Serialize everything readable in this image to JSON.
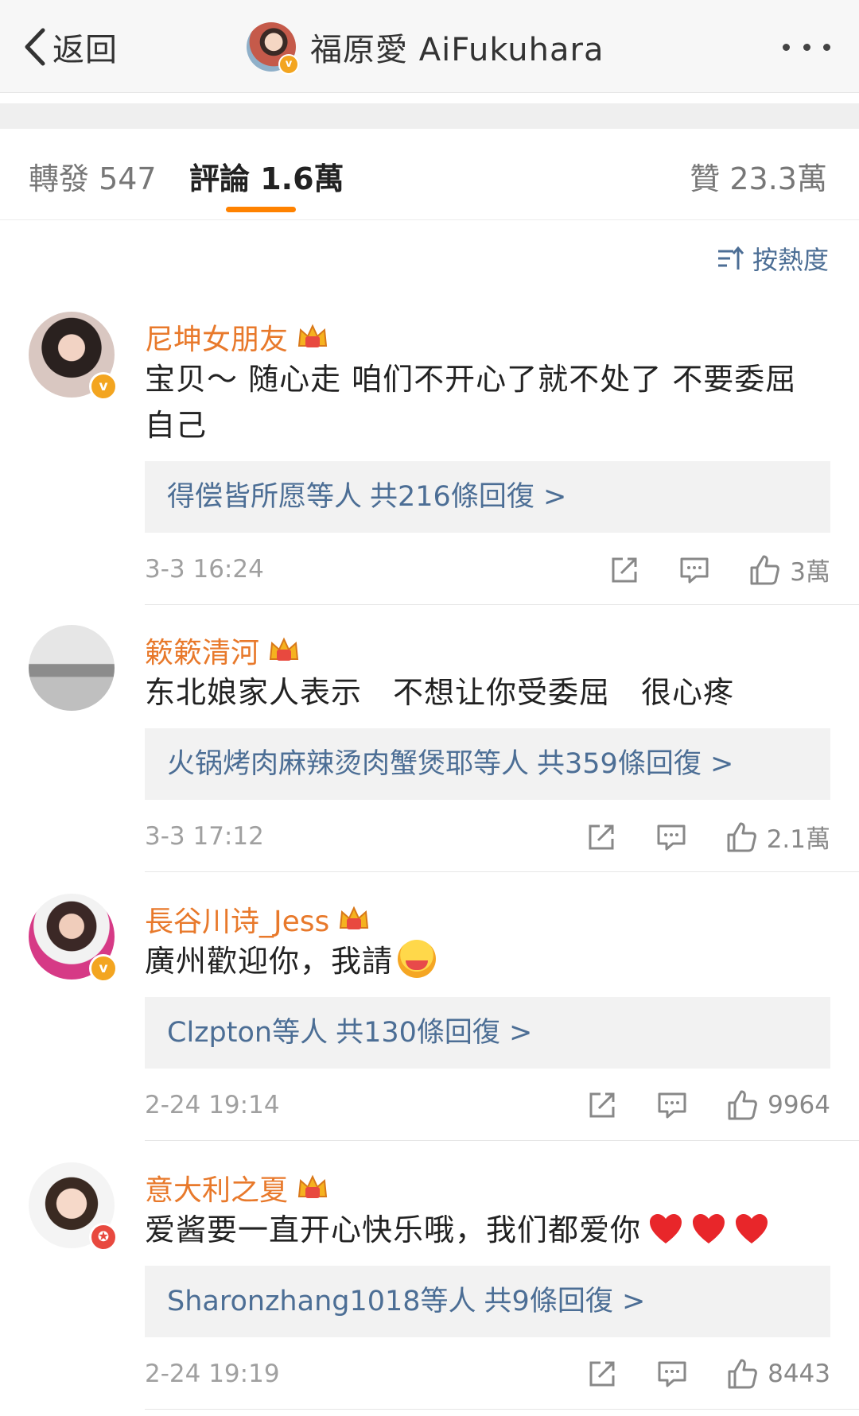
{
  "header": {
    "back_label": "返回",
    "title": "福原愛 AiFukuhara",
    "title_badge": "v"
  },
  "tabs": {
    "repost": "轉發 547",
    "comments": "評論 1.6萬",
    "likes": "贊 23.3萬"
  },
  "sort_label": "按熱度",
  "comments": [
    {
      "name": "尼坤女朋友",
      "badge": "v",
      "text": "宝贝～ 随心走 咱们不开心了就不处了 不要委屈自己",
      "replies_names": "得偿皆所愿等人",
      "replies_count": "共216條回復 >",
      "time": "3-3 16:24",
      "likes": "3萬"
    },
    {
      "name": "簌簌清河",
      "text": "东北娘家人表示　不想让你受委屈　很心疼",
      "replies_names": "火锅烤肉麻辣烫肉蟹煲耶等人",
      "replies_count": "共359條回復 >",
      "time": "3-3 17:12",
      "likes": "2.1萬"
    },
    {
      "name": "長谷川诗_Jess",
      "badge": "v",
      "text": "廣州歡迎你，我請",
      "replies_names": "Clzpton等人",
      "replies_count": "共130條回復 >",
      "time": "2-24 19:14",
      "likes": "9964"
    },
    {
      "name": "意大利之夏",
      "badge": "✪",
      "text": "爱酱要一直开心快乐哦，我们都爱你",
      "replies_names": "Sharonzhang1018等人",
      "replies_count": "共9條回復 >",
      "time": "2-24 19:19",
      "likes": "8443"
    }
  ],
  "colors": {
    "accent": "#ff8200",
    "username": "#e8792b",
    "link": "#4c6e95",
    "badge_yellow": "#f3a520",
    "badge_red": "#e8493f"
  }
}
